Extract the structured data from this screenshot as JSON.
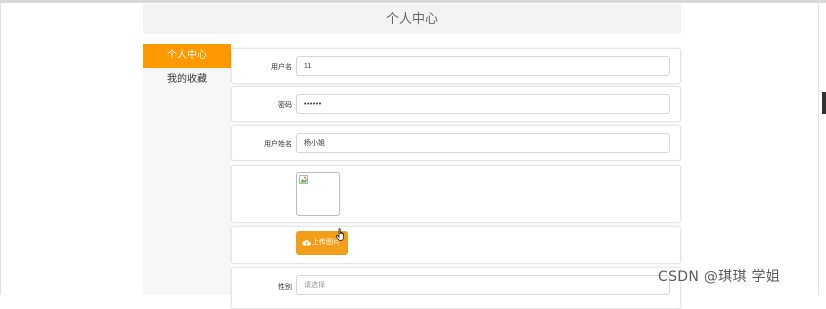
{
  "header": {
    "title": "个人中心"
  },
  "sidebar": {
    "items": [
      {
        "label": "个人中心",
        "active": true
      },
      {
        "label": "我的收藏",
        "active": false
      }
    ]
  },
  "form": {
    "username": {
      "label": "用户名",
      "value": "11"
    },
    "password": {
      "label": "密码",
      "value": "••••••"
    },
    "realname": {
      "label": "用户姓名",
      "value": "杨小姐"
    },
    "upload": {
      "button_label": "上传图片",
      "icon": "cloud-upload-icon"
    },
    "gender": {
      "label": "性别",
      "placeholder": "请选择"
    }
  },
  "watermark": "CSDN @琪琪 学姐",
  "colors": {
    "accent": "#ff9900",
    "upload_button": "#f39d1b"
  }
}
